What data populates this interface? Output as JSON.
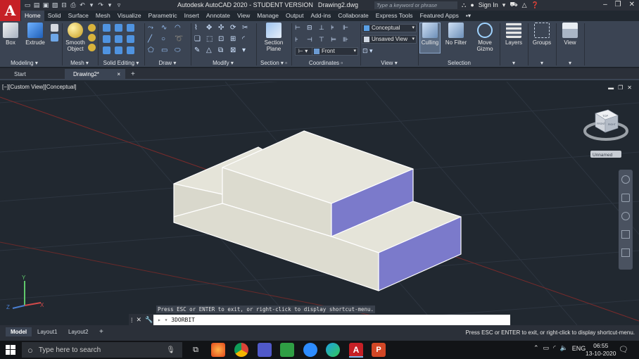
{
  "titlebar": {
    "logo": "A",
    "app_title": "Autodesk AutoCAD 2020 - STUDENT VERSION",
    "doc_title": "Drawing2.dwg",
    "search_placeholder": "Type a keyword or phrase",
    "sign_in": "Sign In"
  },
  "ribbon_tabs": [
    "Home",
    "Solid",
    "Surface",
    "Mesh",
    "Visualize",
    "Parametric",
    "Insert",
    "Annotate",
    "View",
    "Manage",
    "Output",
    "Add-ins",
    "Collaborate",
    "Express Tools",
    "Featured Apps"
  ],
  "ribbon": {
    "modeling": {
      "label": "Modeling",
      "box": "Box",
      "extrude": "Extrude"
    },
    "mesh": {
      "label": "Mesh",
      "smooth_line1": "Smooth",
      "smooth_line2": "Object"
    },
    "solid_editing": {
      "label": "Solid Editing"
    },
    "draw": {
      "label": "Draw"
    },
    "modify": {
      "label": "Modify"
    },
    "section": {
      "label": "Section",
      "plane_line1": "Section",
      "plane_line2": "Plane"
    },
    "coordinates": {
      "label": "Coordinates",
      "view_combo": "Front"
    },
    "view": {
      "label": "View",
      "visual_style": "Conceptual",
      "named_view": "Unsaved View"
    },
    "selection": {
      "label": "Selection",
      "culling": "Culling",
      "no_filter": "No Filter",
      "move_line1": "Move",
      "move_line2": "Gizmo"
    },
    "layers": {
      "label": "Layers"
    },
    "groups": {
      "label": "Groups"
    },
    "view_panel": {
      "label": "View"
    }
  },
  "doc_tabs": {
    "start": "Start",
    "drawing": "Drawing2*",
    "close": "×",
    "add": "+"
  },
  "viewport": {
    "label": "[−][Custom View][Conceptual]",
    "viewcube_label": "Unnamed",
    "viewcube_faces": {
      "top": "TOP",
      "front": "FRONT",
      "right": "RIGHT"
    },
    "axis_y": "Y",
    "axis_x": "X",
    "axis_z": "Z",
    "command_hint": "Press ESC or ENTER to exit, or right-click to display shortcut-menu."
  },
  "command": {
    "text": "3DORBIT"
  },
  "layout_tabs": {
    "model": "Model",
    "layout1": "Layout1",
    "layout2": "Layout2",
    "add": "+"
  },
  "status_message": "Press ESC or ENTER to exit, or right-click to display shortcut-menu.",
  "taskbar": {
    "search_placeholder": "Type here to search",
    "lang": "ENG",
    "time": "06:55",
    "date": "13-10-2020"
  },
  "colors": {
    "face_light": "#e1e0d5",
    "face_side": "#7a7acb",
    "background": "#212830",
    "ribbon": "#3b4453"
  }
}
